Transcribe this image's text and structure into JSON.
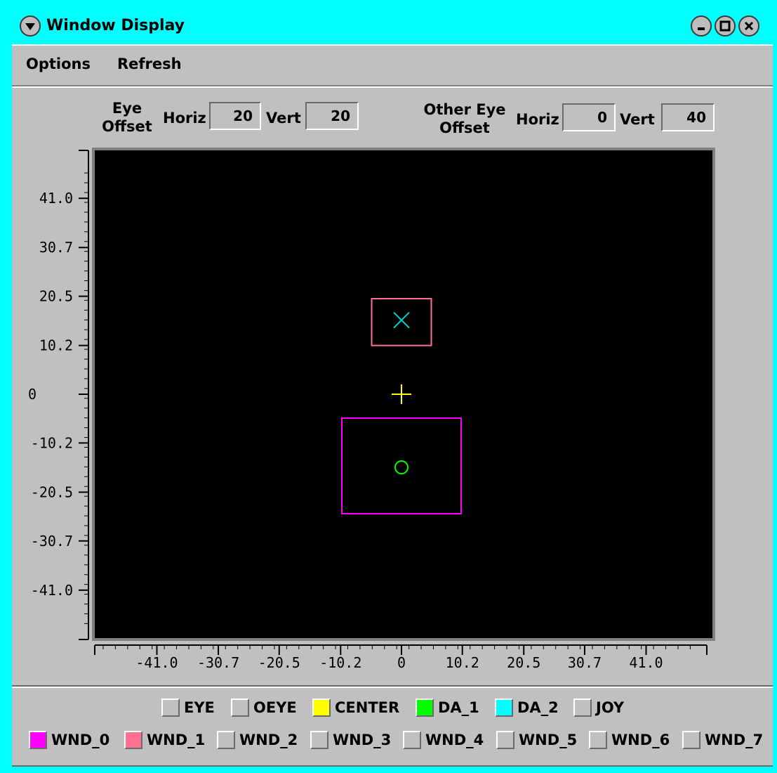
{
  "window": {
    "title": "Window Display"
  },
  "menubar": {
    "items": [
      "Options",
      "Refresh"
    ]
  },
  "eye_offset": {
    "label_line1": "Eye",
    "label_line2": "Offset",
    "horiz_label": "Horiz",
    "horiz_value": "20",
    "vert_label": "Vert",
    "vert_value": "20"
  },
  "other_eye_offset": {
    "label_line1": "Other Eye",
    "label_line2": "Offset",
    "horiz_label": "Horiz",
    "horiz_value": "0",
    "vert_label": "Vert",
    "vert_value": "40"
  },
  "plot": {
    "background": "#000000",
    "y_ticks": [
      "41.0",
      "30.7",
      "20.5",
      "10.2",
      "0",
      "-10.2",
      "-20.5",
      "-30.7",
      "-41.0"
    ],
    "x_ticks": [
      "-41.0",
      "-30.7",
      "-20.5",
      "-10.2",
      "0",
      "10.2",
      "20.5",
      "30.7",
      "41.0"
    ],
    "objects": [
      {
        "name": "WND_1 window",
        "type": "rect",
        "color": "#ff6f8f",
        "x_min": -5,
        "x_max": 5,
        "y_min": 10.2,
        "y_max": 20
      },
      {
        "name": "DA_2 marker",
        "type": "x-marker",
        "color": "#00d0d0",
        "x": 0,
        "y": 15.5
      },
      {
        "name": "CENTER marker",
        "type": "plus-marker",
        "color": "#ffff00",
        "x": 0,
        "y": 0
      },
      {
        "name": "WND_0 window",
        "type": "rect",
        "color": "#ff00ff",
        "x_min": -10,
        "x_max": 10,
        "y_min": -25,
        "y_max": -5
      },
      {
        "name": "DA_1 marker",
        "type": "circle-marker",
        "color": "#00ff00",
        "x": 0,
        "y": -15.3
      }
    ]
  },
  "legend": {
    "row1": [
      {
        "label": "EYE",
        "color": "#c0c0c0"
      },
      {
        "label": "OEYE",
        "color": "#c0c0c0"
      },
      {
        "label": "CENTER",
        "color": "#ffff00"
      },
      {
        "label": "DA_1",
        "color": "#00ff00"
      },
      {
        "label": "DA_2",
        "color": "#00ffff"
      },
      {
        "label": "JOY",
        "color": "#c0c0c0"
      }
    ],
    "row2": [
      {
        "label": "WND_0",
        "color": "#ff00ff"
      },
      {
        "label": "WND_1",
        "color": "#ff6f8f"
      },
      {
        "label": "WND_2",
        "color": "#c0c0c0"
      },
      {
        "label": "WND_3",
        "color": "#c0c0c0"
      },
      {
        "label": "WND_4",
        "color": "#c0c0c0"
      },
      {
        "label": "WND_5",
        "color": "#c0c0c0"
      },
      {
        "label": "WND_6",
        "color": "#c0c0c0"
      },
      {
        "label": "WND_7",
        "color": "#c0c0c0"
      }
    ]
  }
}
